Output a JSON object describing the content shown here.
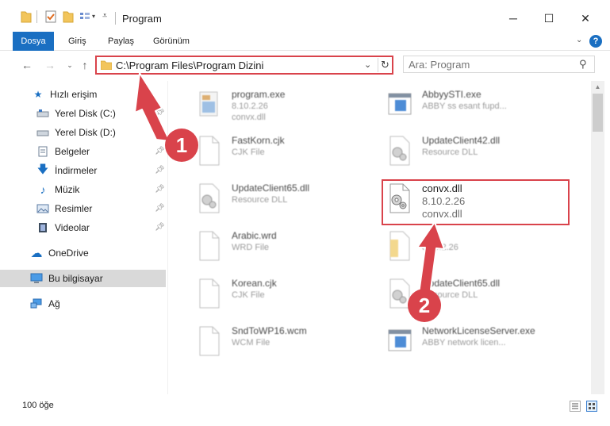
{
  "window": {
    "title": "Program",
    "minimize_label": "─",
    "maximize_label": "☐",
    "close_label": "✕"
  },
  "ribbon": {
    "tabs": [
      "Dosya",
      "Giriş",
      "Paylaş",
      "Görünüm"
    ],
    "help_label": "?"
  },
  "navigation": {
    "address_path": "C:\\Program Files\\Program Dizini",
    "search_placeholder": "Ara: Program"
  },
  "sidebar": {
    "items": [
      {
        "label": "Hızlı erişim",
        "icon": "star-icon",
        "pinned": false
      },
      {
        "label": "Yerel Disk (C:)",
        "icon": "drive-icon",
        "pinned": true
      },
      {
        "label": "Yerel Disk (D:)",
        "icon": "drive-icon",
        "pinned": true
      },
      {
        "label": "Belgeler",
        "icon": "documents-icon",
        "pinned": true
      },
      {
        "label": "İndirmeler",
        "icon": "download-icon",
        "pinned": true
      },
      {
        "label": "Müzik",
        "icon": "music-icon",
        "pinned": true
      },
      {
        "label": "Resimler",
        "icon": "pictures-icon",
        "pinned": true
      },
      {
        "label": "Videolar",
        "icon": "videos-icon",
        "pinned": true
      },
      {
        "label": "OneDrive",
        "icon": "cloud-icon",
        "pinned": false
      },
      {
        "label": "Bu bilgisayar",
        "icon": "computer-icon",
        "pinned": false,
        "selected": true
      },
      {
        "label": "Ağ",
        "icon": "network-icon",
        "pinned": false
      }
    ]
  },
  "files": [
    {
      "name": "program.exe",
      "version": "8.10.2.26",
      "description": "convx.dll",
      "icon": "exe-icon"
    },
    {
      "name": "AbbyySTI.exe",
      "version": "ABBY ss esant fupd...",
      "description": "",
      "icon": "app-window-icon"
    },
    {
      "name": "FastKorn.cjk",
      "version": "CJK File",
      "description": "",
      "icon": "blank-file-icon"
    },
    {
      "name": "UpdateClient42.dll",
      "version": "Resource DLL",
      "description": "",
      "icon": "dll-gear-icon"
    },
    {
      "name": "UpdateClient65.dll",
      "version": "Resource DLL",
      "description": "",
      "icon": "dll-gear-icon"
    },
    {
      "name": "convx.dll",
      "version": "8.10.2.26",
      "description": "convx.dll",
      "icon": "dll-gear-icon"
    },
    {
      "name": "Arabic.wrd",
      "version": "WRD File",
      "description": "",
      "icon": "blank-file-icon"
    },
    {
      "name": "",
      "version": "8.10.2.26",
      "description": "",
      "icon": "folder-file-icon"
    },
    {
      "name": "Korean.cjk",
      "version": "CJK File",
      "description": "",
      "icon": "blank-file-icon"
    },
    {
      "name": "UpdateClient65.dll",
      "version": "Resource DLL",
      "description": "",
      "icon": "dll-gear-icon"
    },
    {
      "name": "SndToWP16.wcm",
      "version": "WCM File",
      "description": "",
      "icon": "blank-file-icon"
    },
    {
      "name": "NetworkLicenseServer.exe",
      "version": "ABBY network licen...",
      "description": "",
      "icon": "app-window-icon"
    }
  ],
  "status": {
    "item_count": "100 öğe"
  },
  "annotations": {
    "badge_1": "1",
    "badge_2": "2"
  },
  "colors": {
    "accent": "#1a6fc2",
    "highlight": "#d9434b"
  }
}
